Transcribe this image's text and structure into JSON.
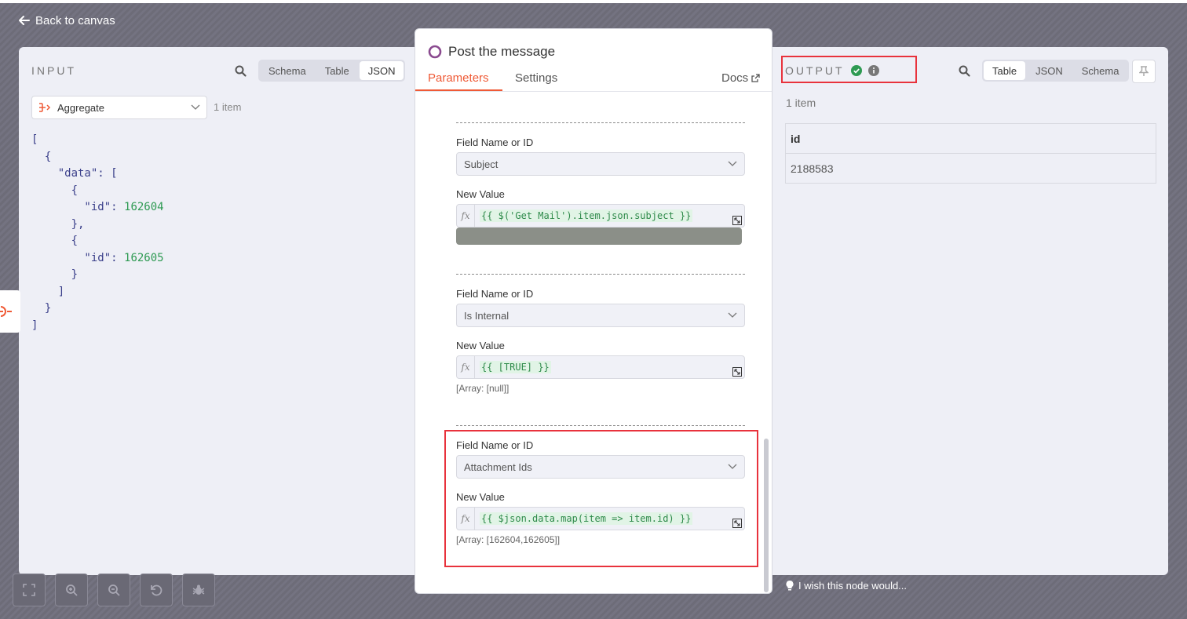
{
  "header": {
    "back_label": "Back to canvas"
  },
  "input": {
    "title": "INPUT",
    "view_tabs": [
      "Schema",
      "Table",
      "JSON"
    ],
    "active_tab": "JSON",
    "node_select": "Aggregate",
    "item_count": "1 item",
    "json_lines": [
      "[",
      "  {",
      "    \"data\": [",
      "      {",
      "        \"id\": ",
      "      },",
      "      {",
      "        \"id\": ",
      "      }",
      "    ]",
      "  }",
      "]"
    ],
    "ids": [
      "162604",
      "162605"
    ]
  },
  "output": {
    "title": "OUTPUT",
    "view_tabs": [
      "Table",
      "JSON",
      "Schema"
    ],
    "active_tab": "Table",
    "item_count": "1 item",
    "table": {
      "columns": [
        "id"
      ],
      "rows": [
        [
          "2188583"
        ]
      ]
    },
    "feedback": "I wish this node would..."
  },
  "modal": {
    "title": "Post the message",
    "tabs": [
      "Parameters",
      "Settings"
    ],
    "active_tab": "Parameters",
    "docs_label": "Docs",
    "fields": [
      {
        "name_label": "Field Name or ID",
        "name_value": "Subject",
        "value_label": "New Value",
        "expression": "{{ $('Get Mail').item.json.subject }}",
        "hint": ""
      },
      {
        "name_label": "Field Name or ID",
        "name_value": "Is Internal",
        "value_label": "New Value",
        "expression": "{{ [TRUE] }}",
        "hint": "[Array: [null]]"
      },
      {
        "name_label": "Field Name or ID",
        "name_value": "Attachment Ids",
        "value_label": "New Value",
        "expression": "{{ $json.data.map(item => item.id) }}",
        "hint": "[Array: [162604,162605]]"
      }
    ]
  },
  "colors": {
    "accent": "#ef5a36",
    "highlight": "#e8323c",
    "success": "#2e9a52",
    "json_key": "#3a3f8a"
  },
  "toolbar_icons": [
    "fit-view-icon",
    "zoom-in-icon",
    "zoom-out-icon",
    "reset-zoom-icon",
    "debug-icon"
  ]
}
